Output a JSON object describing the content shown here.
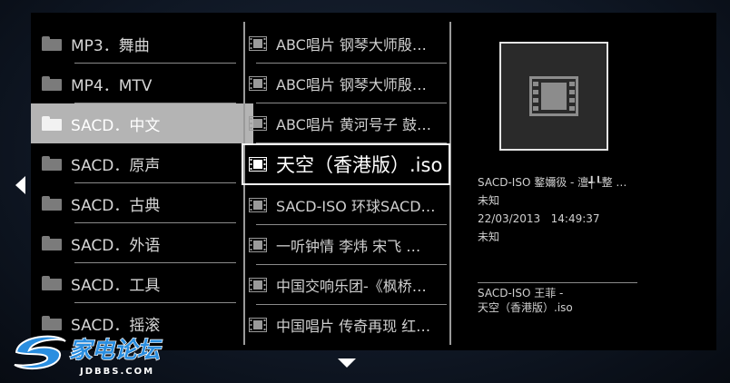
{
  "folders": [
    {
      "label": "MP3．舞曲",
      "selected": false
    },
    {
      "label": "MP4．MTV",
      "selected": false
    },
    {
      "label": "SACD．中文",
      "selected": true
    },
    {
      "label": "SACD．原声",
      "selected": false
    },
    {
      "label": "SACD．古典",
      "selected": false
    },
    {
      "label": "SACD．外语",
      "selected": false
    },
    {
      "label": "SACD．工具",
      "selected": false
    },
    {
      "label": "SACD．摇滚",
      "selected": false
    }
  ],
  "files": [
    {
      "label": "ABC唱片 钢琴大师殷…",
      "focused": false
    },
    {
      "label": "ABC唱片 钢琴大师殷…",
      "focused": false
    },
    {
      "label": "ABC唱片 黄河号子 鼓…",
      "focused": false
    },
    {
      "label": "天空（香港版）.iso",
      "focused": true
    },
    {
      "label": "SACD-ISO 环球SACD…",
      "focused": false
    },
    {
      "label": "一听钟情 李炜 宋飞 …",
      "focused": false
    },
    {
      "label": "中国交响乐团-《枫桥…",
      "focused": false
    },
    {
      "label": "中国唱片 传奇再现 红…",
      "focused": false
    }
  ],
  "details": {
    "title": "SACD-ISO 鐜嬭彶 - 澶╃┖整 …",
    "artist": "未知",
    "date": "22/03/2013",
    "time": "14:49:37",
    "genre": "未知"
  },
  "path": {
    "line1": "SACD-ISO 王菲 -",
    "line2": "天空（香港版）.iso"
  },
  "icons": {
    "folder": "folder-icon",
    "file": "film-icon",
    "preview": "film-icon",
    "nav_left": "arrow-left-icon",
    "nav_down": "arrow-down-icon"
  },
  "logo": {
    "text": "家电论坛",
    "subtext": "JDBBS.COM"
  },
  "colors": {
    "selected_bg": "#b4b4b4",
    "focus_border": "#f5f5f5",
    "logo_blue": "#2a8ee0"
  }
}
